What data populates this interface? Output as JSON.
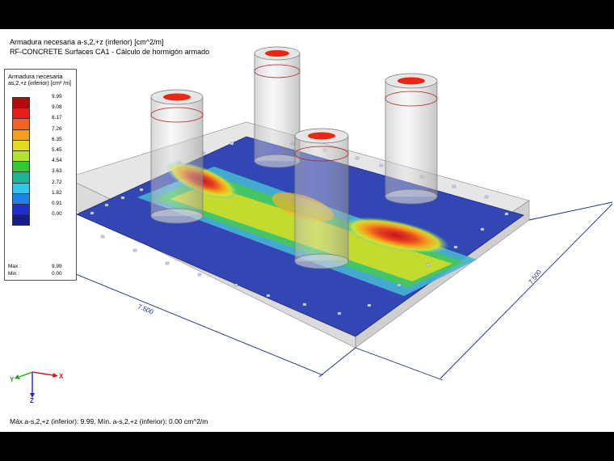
{
  "header": {
    "line1": "Armadura necesaria a-s,2,+z (inferior) [cm^2/m]",
    "line2": "RF-CONCRETE Surfaces CA1 - Cálculo de hormigón armado"
  },
  "legend": {
    "title": "Armadura necesaria",
    "subtitle": "as,2,+z (inferior) [cm² /m]",
    "items": [
      {
        "label": "9.99",
        "color": "#b40a0a"
      },
      {
        "label": "9.08",
        "color": "#e61e14"
      },
      {
        "label": "8.17",
        "color": "#f2641e"
      },
      {
        "label": "7.26",
        "color": "#f7a01c"
      },
      {
        "label": "6.35",
        "color": "#e6dc1e"
      },
      {
        "label": "5.45",
        "color": "#b4e132"
      },
      {
        "label": "4.54",
        "color": "#32c832"
      },
      {
        "label": "3.63",
        "color": "#1eb496"
      },
      {
        "label": "2.72",
        "color": "#32c8e6"
      },
      {
        "label": "1.82",
        "color": "#1e82e6"
      },
      {
        "label": "0.91",
        "color": "#1e32c8"
      },
      {
        "label": "0.00",
        "color": "#141e8c"
      }
    ],
    "max_label": "Max :",
    "max_value": "9.99",
    "min_label": "Min :",
    "min_value": "0.00"
  },
  "dimensions": {
    "front": "7.500",
    "right": "7.500"
  },
  "axes": {
    "x": "X",
    "y": "Y",
    "z": "Z"
  },
  "status": {
    "text": "Máx.a-s,2,+z (inferior): 9.99, Mín. a-s,2,+z (inferior): 0.00 cm^2/m"
  }
}
